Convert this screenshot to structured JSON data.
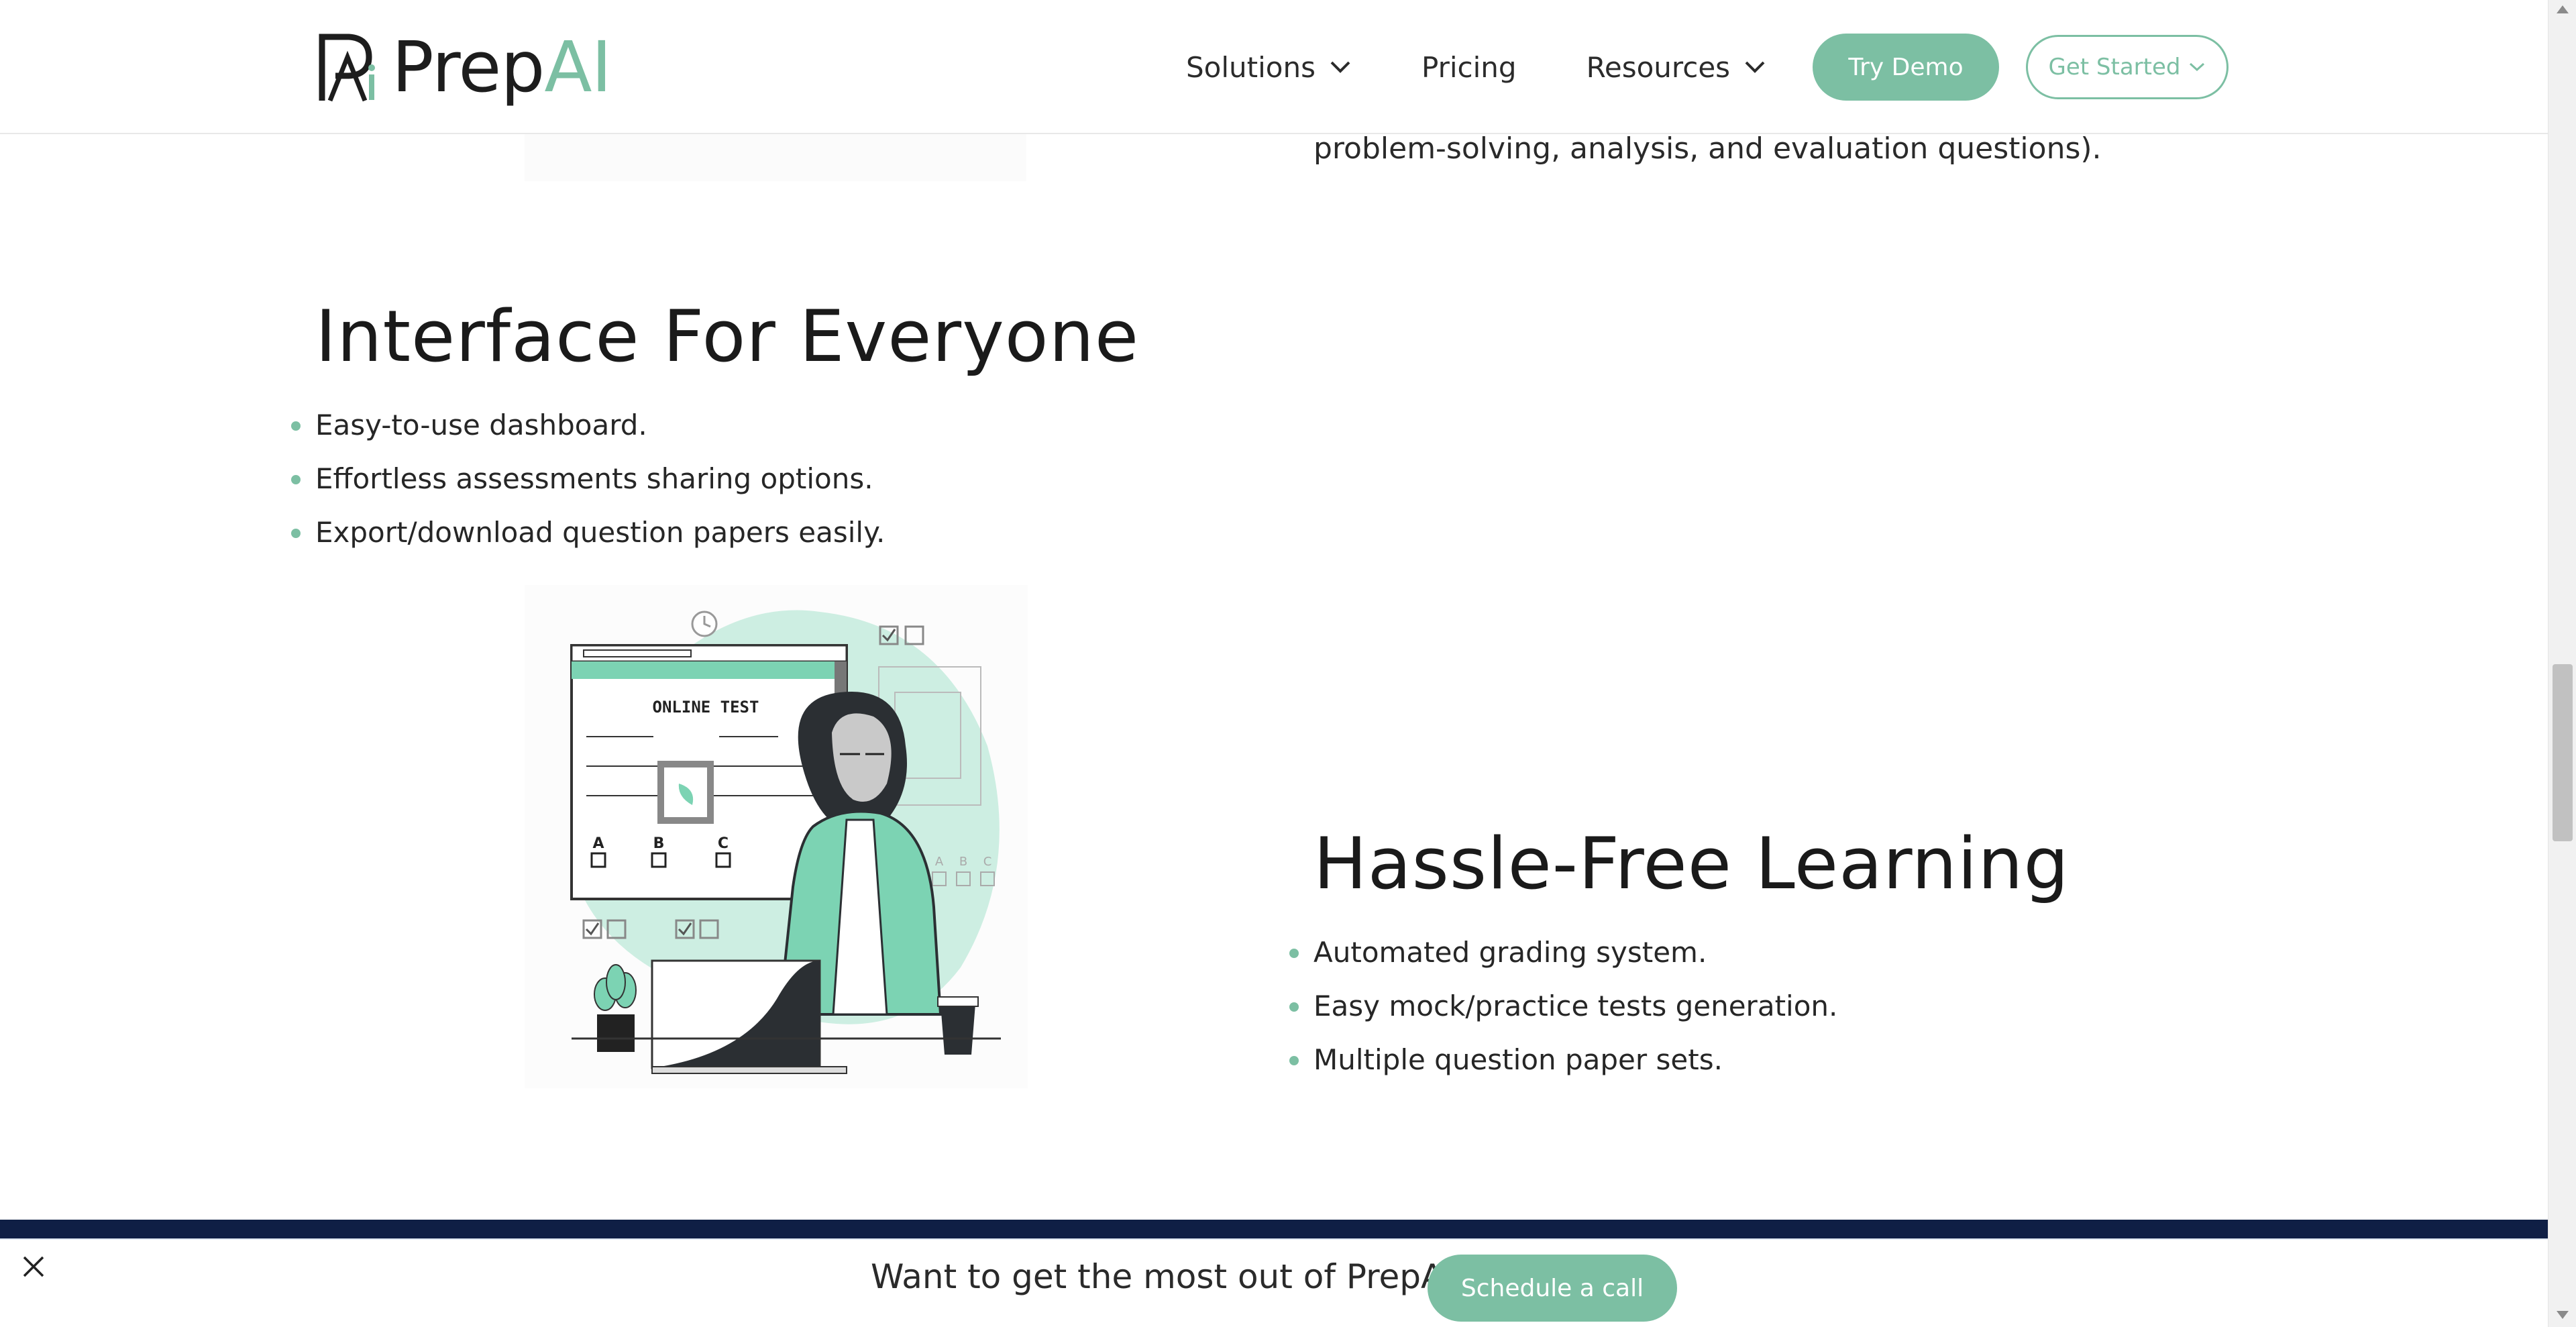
{
  "header": {
    "logo_text_dark": "Prep",
    "logo_text_green": "AI",
    "nav": [
      {
        "label": "Solutions",
        "icon": "chevron-down-icon"
      },
      {
        "label": "Pricing"
      },
      {
        "label": "Resources",
        "icon": "chevron-down-icon"
      }
    ],
    "try_demo_label": "Try Demo",
    "get_started_label": "Get Started"
  },
  "content": {
    "partial_text": "problem-solving, analysis, and evaluation questions).",
    "section1": {
      "title": "Interface For Everyone",
      "bullets": [
        "Easy-to-use dashboard.",
        "Effortless assessments sharing options.",
        "Export/download question papers easily."
      ]
    },
    "illustration": {
      "screen_title": "ONLINE TEST",
      "options": [
        "A",
        "B",
        "C"
      ],
      "side_options": [
        "A",
        "B",
        "C"
      ]
    },
    "section2": {
      "title": "Hassle-Free Learning",
      "bullets": [
        "Automated grading system.",
        "Easy mock/practice tests generation.",
        "Multiple question paper sets."
      ]
    }
  },
  "bottom_bar": {
    "text": "Want to get the most out of PrepAI?",
    "cta_label": "Schedule a call"
  },
  "colors": {
    "accent": "#7cbfa3",
    "navy": "#0f1f45",
    "text": "#1f1f1f"
  }
}
